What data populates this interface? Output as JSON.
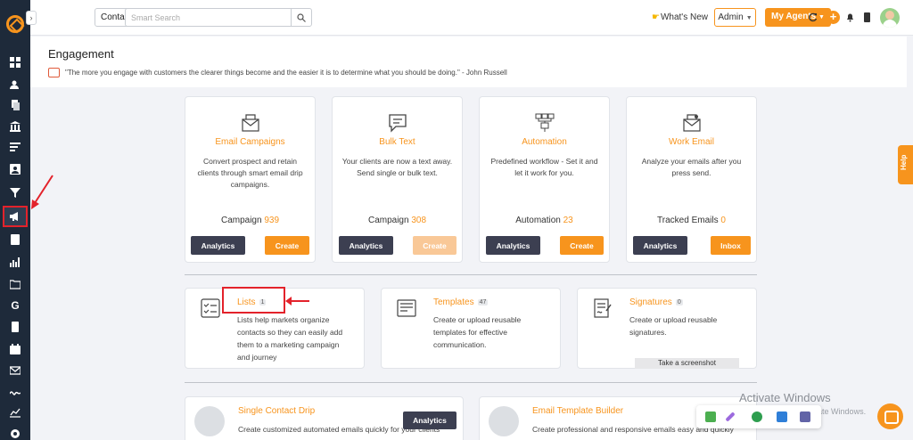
{
  "topbar": {
    "contact_select": "Contact",
    "search_placeholder": "Smart Search",
    "whats_new": "What's New",
    "admin": "Admin",
    "my_agents": "My Agents"
  },
  "page": {
    "title": "Engagement",
    "quote": "\"The more you engage with customers the clearer things become and the easier it is to determine what you should be doing.\" - John Russell"
  },
  "cards": [
    {
      "title": "Email Campaigns",
      "desc": "Convert prospect and retain clients through smart email drip campaigns.",
      "metric_label": "Campaign",
      "metric_value": "939",
      "left_button": "Analytics",
      "right_button": "Create"
    },
    {
      "title": "Bulk Text",
      "desc": "Your clients are now a text away. Send single or bulk text.",
      "metric_label": "Campaign",
      "metric_value": "308",
      "left_button": "Analytics",
      "right_button": "Create"
    },
    {
      "title": "Automation",
      "desc": "Predefined workflow - Set it and let it work for you.",
      "metric_label": "Automation",
      "metric_value": "23",
      "left_button": "Analytics",
      "right_button": "Create"
    },
    {
      "title": "Work Email",
      "desc": "Analyze your emails after you press send.",
      "metric_label": "Tracked Emails",
      "metric_value": "0",
      "left_button": "Analytics",
      "right_button": "Inbox"
    }
  ],
  "tools": [
    {
      "title": "Lists",
      "count": "1",
      "desc_lines": [
        "Lists help markets organize",
        "contacts so they can easily add",
        "them to a marketing campaign",
        "and journey"
      ]
    },
    {
      "title": "Templates",
      "count": "47",
      "desc_lines": [
        "Create or upload reusable",
        "templates for effective",
        "communication."
      ]
    },
    {
      "title": "Signatures",
      "count": "0",
      "desc_lines": [
        "Create or upload reusable",
        "signatures."
      ]
    }
  ],
  "screenshot_button": "Take a screenshot",
  "bottom_cards": [
    {
      "title": "Single Contact Drip",
      "desc": "Create customized automated emails quickly for your clients",
      "button": "Analytics"
    },
    {
      "title": "Email Template Builder",
      "desc": "Create professional and responsive emails easy and quickly"
    }
  ],
  "overlay": {
    "activate_title": "Activate Windows",
    "activate_sub": "Go to Settings to activate Windows.",
    "help": "Help"
  },
  "colors": {
    "accent": "#f7941d",
    "sidebar": "#1e2a3a",
    "highlight": "#e3222b",
    "dark_button": "#3c3f51"
  }
}
